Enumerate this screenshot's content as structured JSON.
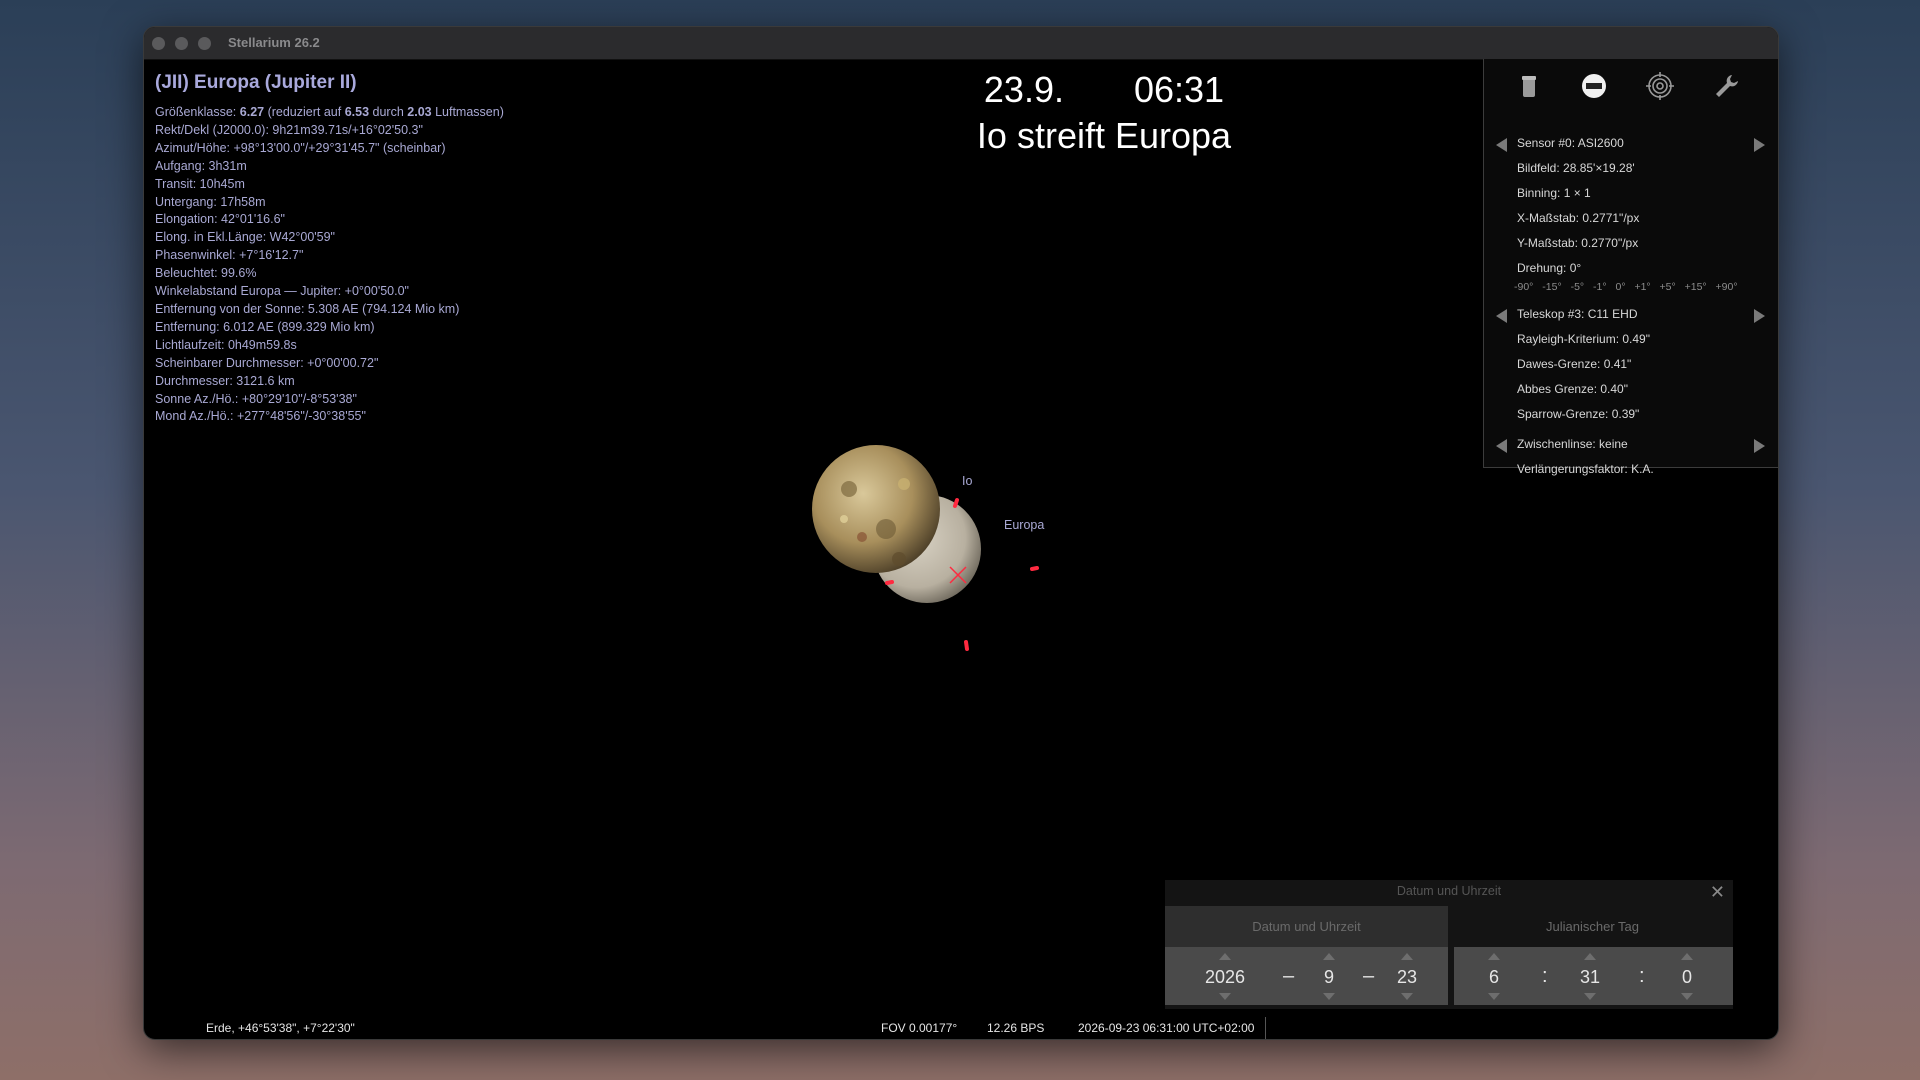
{
  "window": {
    "title": "Stellarium 26.2"
  },
  "info": {
    "title": "(JII) Europa (Jupiter II)",
    "mag": {
      "label": "Größenklasse: ",
      "value": "6.27",
      "p1": " (reduziert auf ",
      "v2": "6.53",
      "p2": " durch ",
      "v3": "2.03",
      "p3": " Luftmassen)"
    },
    "lines": [
      "Rekt/Dekl (J2000.0): 9h21m39.71s/+16°02'50.3\"",
      "Azimut/Höhe: +98°13'00.0\"/+29°31'45.7\" (scheinbar)",
      "Aufgang: 3h31m",
      "Transit: 10h45m",
      "Untergang: 17h58m",
      "Elongation: 42°01'16.6\"",
      "Elong. in Ekl.Länge: W42°00'59\"",
      "Phasenwinkel: +7°16'12.7\"",
      "Beleuchtet: 99.6%",
      "Winkelabstand Europa — Jupiter: +0°00'50.0\"",
      "Entfernung von der Sonne: 5.308 AE (794.124 Mio km)",
      "Entfernung: 6.012 AE (899.329 Mio km)",
      "Lichtlaufzeit: 0h49m59.8s",
      "Scheinbarer Durchmesser: +0°00'00.72\"",
      "Durchmesser: 3121.6 km",
      "Sonne Az./Hö.: +80°29'10\"/-8°53'38\"",
      "Mond Az./Hö.: +277°48'56\"/-30°38'55\""
    ]
  },
  "overlay": {
    "date": "23.9.",
    "time": "06:31",
    "event": "Io streift Europa"
  },
  "sky": {
    "labels": {
      "io": "Io",
      "europa": "Europa"
    }
  },
  "ocular": {
    "icons": [
      "ocular-icon",
      "sensor-icon",
      "telrad-icon",
      "wrench-icon"
    ],
    "sensor": "Sensor #0: ASI2600",
    "sensor_lines": [
      "Bildfeld: 28.85'×19.28'",
      "Binning: 1 × 1",
      "X-Maßstab: 0.2771\"/px",
      "Y-Maßstab: 0.2770\"/px",
      "Drehung: 0°"
    ],
    "rotation": "-90° -15° -5° -1° 0° +1° +5° +15° +90°",
    "telescope": "Teleskop #3: C11 EHD",
    "telescope_lines": [
      "Rayleigh-Kriterium: 0.49\"",
      "Dawes-Grenze: 0.41\"",
      "Abbes Grenze: 0.40\"",
      "Sparrow-Grenze: 0.39\""
    ],
    "lens": "Zwischenlinse: keine",
    "lens_line": "Verlängerungsfaktor: K.A."
  },
  "datetime": {
    "header": "Datum und Uhrzeit",
    "tab1": "Datum und Uhrzeit",
    "tab2": "Julianischer Tag",
    "year": "2026",
    "month": "9",
    "day": "23",
    "hour": "6",
    "minute": "31",
    "second": "0",
    "dash": "–",
    "colon": ":"
  },
  "status": {
    "location": "Erde, +46°53'38\", +7°22'30\"",
    "fov": "FOV 0.00177°",
    "fps": "12.26 BPS",
    "datetime": "2026-09-23 06:31:00 UTC+02:00"
  },
  "colors": {
    "info_text": "#a9a9d4",
    "marker": "#ff2a40"
  }
}
